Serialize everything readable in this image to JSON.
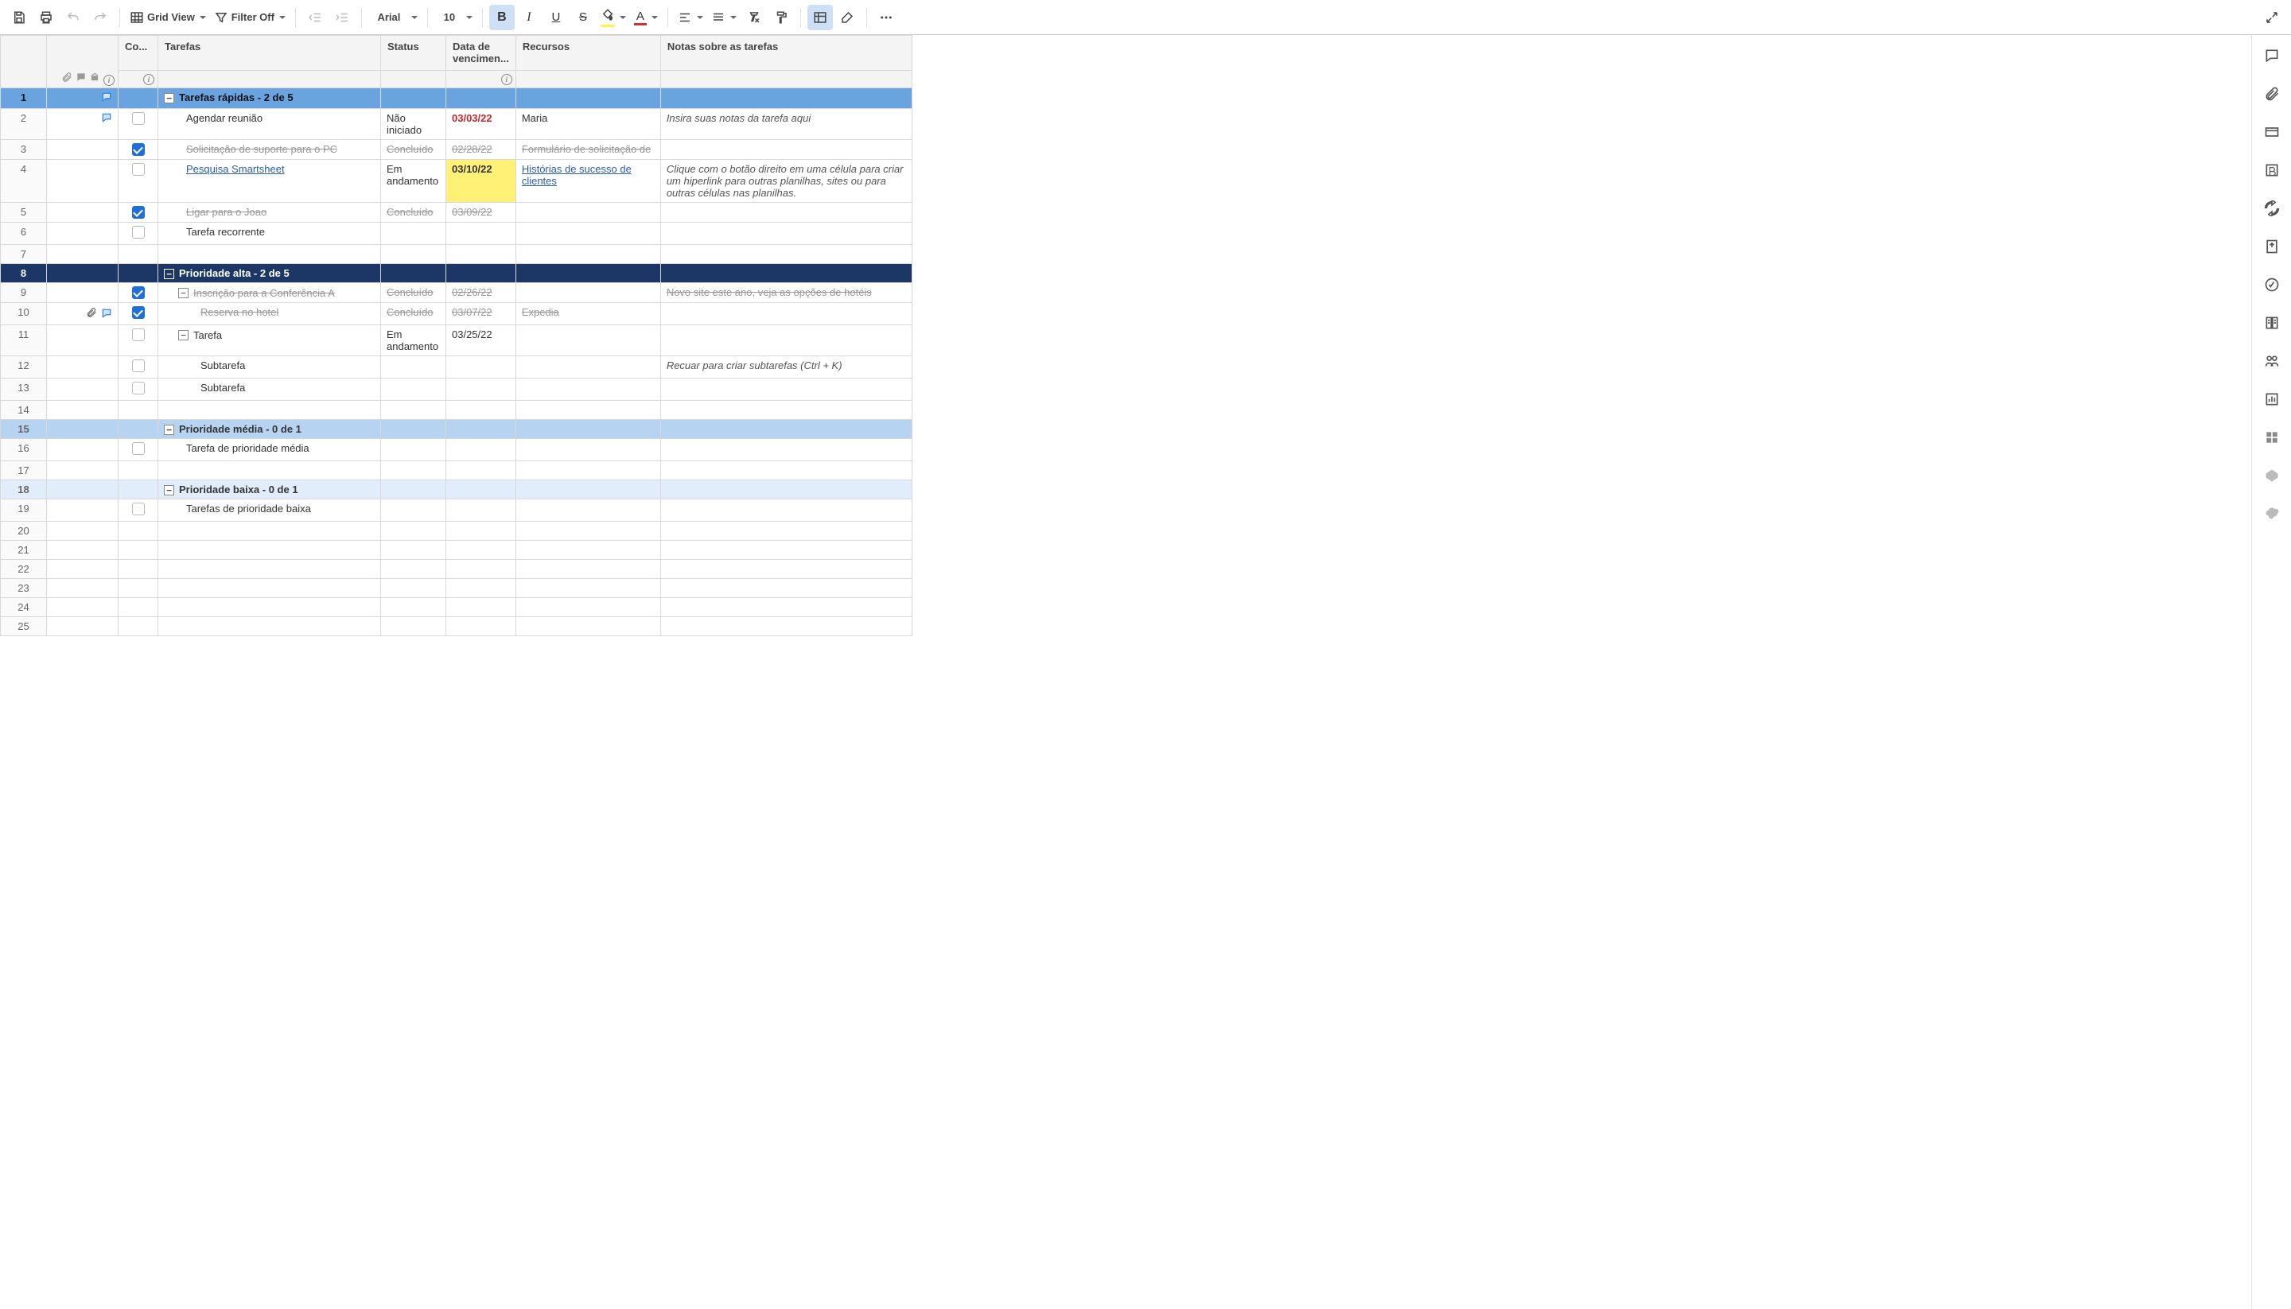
{
  "toolbar": {
    "view_label": "Grid View",
    "filter_label": "Filter Off",
    "font_name": "Arial",
    "font_size": "10"
  },
  "columns": {
    "chk": "Co...",
    "task": "Tarefas",
    "status": "Status",
    "date": "Data de vencimen...",
    "resource": "Recursos",
    "notes": "Notas sobre as tarefas"
  },
  "rows": [
    {
      "n": 1,
      "type": "section",
      "style": "blue",
      "comment": true,
      "task": "Tarefas rápidas - 2 de 5"
    },
    {
      "n": 2,
      "type": "task",
      "comment": true,
      "chk": false,
      "indent": 1,
      "task": "Agendar reunião",
      "status": "Não iniciado",
      "date": "03/03/22",
      "date_style": "red",
      "resource": "Maria",
      "notes": "Insira suas notas da tarefa aqui",
      "notes_italic": true
    },
    {
      "n": 3,
      "type": "task",
      "chk": true,
      "indent": 1,
      "strike": true,
      "task": "Solicitação de suporte para o PC",
      "status": "Concluído",
      "date": "02/28/22",
      "resource": "Formulário de solicitação de"
    },
    {
      "n": 4,
      "type": "task",
      "chk": false,
      "indent": 1,
      "task": "Pesquisa Smartsheet",
      "task_link": true,
      "status": "Em andamento",
      "date": "03/10/22",
      "date_style": "yellow",
      "resource": "Histórias de sucesso de clientes",
      "resource_link": true,
      "notes": "Clique com o botão direito em uma célula para criar um hiperlink para outras planilhas, sites ou para outras células nas planilhas.",
      "notes_italic": true
    },
    {
      "n": 5,
      "type": "task",
      "chk": true,
      "indent": 1,
      "strike": true,
      "task": "Ligar para o Joao",
      "status": "Concluído",
      "date": "03/09/22"
    },
    {
      "n": 6,
      "type": "task",
      "chk": false,
      "indent": 1,
      "task": "Tarefa recorrente"
    },
    {
      "n": 7,
      "type": "empty"
    },
    {
      "n": 8,
      "type": "section",
      "style": "navy",
      "task": "Prioridade alta - 2 de 5"
    },
    {
      "n": 9,
      "type": "task",
      "chk": true,
      "indent": 1,
      "collapse": true,
      "strike": true,
      "task": "Inscrição para a Conferência A",
      "status": "Concluído",
      "date": "02/26/22",
      "notes": "Novo site este ano, veja as opções de hotéis"
    },
    {
      "n": 10,
      "type": "task",
      "attach": true,
      "comment": true,
      "chk": true,
      "indent": 2,
      "strike": true,
      "task": "Reserva no hotel",
      "status": "Concluído",
      "date": "03/07/22",
      "resource": "Expedia"
    },
    {
      "n": 11,
      "type": "task",
      "chk": false,
      "indent": 1,
      "collapse": true,
      "task": "Tarefa",
      "status": "Em andamento",
      "date": "03/25/22"
    },
    {
      "n": 12,
      "type": "task",
      "chk": false,
      "indent": 2,
      "task": "Subtarefa",
      "notes": "Recuar para criar subtarefas (Ctrl + K)",
      "notes_italic": true
    },
    {
      "n": 13,
      "type": "task",
      "chk": false,
      "indent": 2,
      "task": "Subtarefa"
    },
    {
      "n": 14,
      "type": "empty"
    },
    {
      "n": 15,
      "type": "section",
      "style": "lightblue",
      "task": "Prioridade média - 0 de 1"
    },
    {
      "n": 16,
      "type": "task",
      "chk": false,
      "indent": 1,
      "task": "Tarefa de prioridade média"
    },
    {
      "n": 17,
      "type": "empty"
    },
    {
      "n": 18,
      "type": "section",
      "style": "paleblue",
      "task": "Prioridade baixa - 0 de 1"
    },
    {
      "n": 19,
      "type": "task",
      "chk": false,
      "indent": 1,
      "task": "Tarefas de prioridade baixa"
    },
    {
      "n": 20,
      "type": "empty"
    },
    {
      "n": 21,
      "type": "empty"
    },
    {
      "n": 22,
      "type": "empty"
    },
    {
      "n": 23,
      "type": "empty"
    },
    {
      "n": 24,
      "type": "empty"
    },
    {
      "n": 25,
      "type": "empty"
    }
  ]
}
